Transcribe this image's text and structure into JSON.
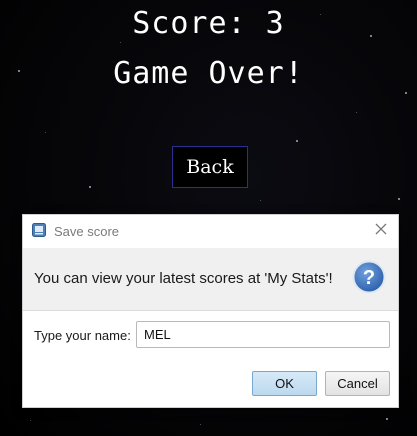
{
  "game": {
    "score_text": "Score: 3",
    "status_text": "Game Over!",
    "back_label": "Back"
  },
  "dialog": {
    "title": "Save score",
    "message": "You can view your latest scores at 'My Stats'!",
    "name_label": "Type your name:",
    "name_value": "MEL",
    "ok_label": "OK",
    "cancel_label": "Cancel",
    "icons": {
      "app": "java-app-icon",
      "close": "close-icon",
      "help": "question-icon"
    }
  },
  "colors": {
    "background": "#000000",
    "text": "#ffffff",
    "back_button_border": "#2b2f8f",
    "help_icon": "#3a6fb8",
    "ok_button": "#bcd9ef"
  }
}
